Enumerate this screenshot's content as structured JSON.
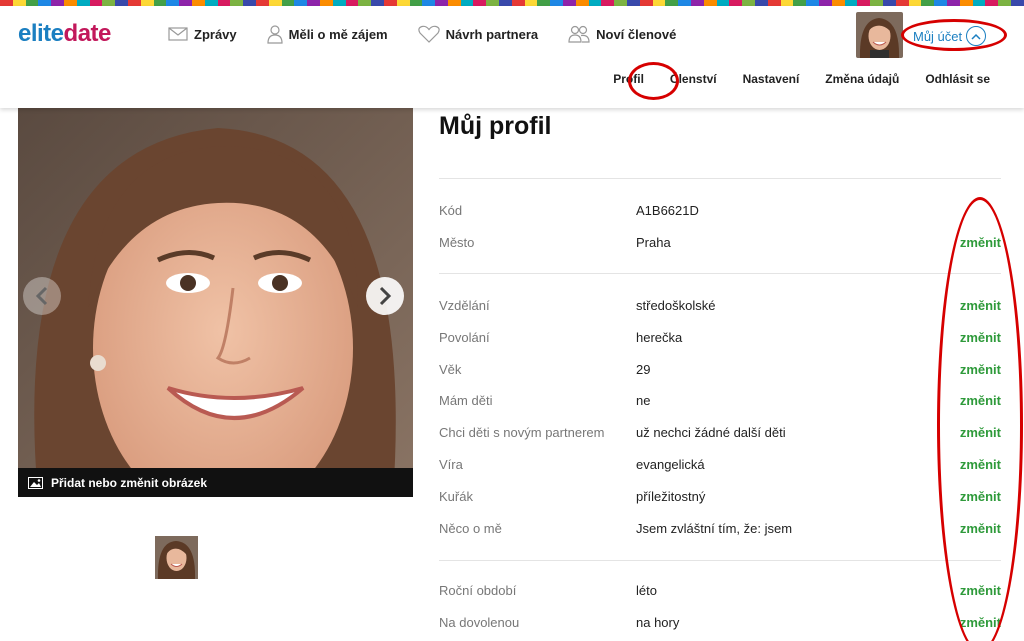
{
  "header": {
    "logo_part1": "elite",
    "logo_part2": "date",
    "nav": [
      {
        "label": "Zprávy",
        "icon": "envelope-icon"
      },
      {
        "label": "Měli o mě zájem",
        "icon": "person-icon"
      },
      {
        "label": "Návrh partnera",
        "icon": "heart-icon"
      },
      {
        "label": "Noví členové",
        "icon": "people-icon"
      }
    ],
    "account_label": "Můj účet",
    "subnav": [
      "Profil",
      "Členství",
      "Nastavení",
      "Změna údajů",
      "Odhlásit se"
    ]
  },
  "photo": {
    "caption": "Přidat nebo změnit obrázek"
  },
  "profile": {
    "title": "Můj profil",
    "change_label": "změnit",
    "group1": [
      {
        "label": "Kód",
        "value": "A1B6621D",
        "editable": false
      },
      {
        "label": "Město",
        "value": "Praha",
        "editable": true
      }
    ],
    "group2": [
      {
        "label": "Vzdělání",
        "value": "středoškolské",
        "editable": true
      },
      {
        "label": "Povolání",
        "value": "herečka",
        "editable": true
      },
      {
        "label": "Věk",
        "value": "29",
        "editable": true
      },
      {
        "label": "Mám děti",
        "value": "ne",
        "editable": true
      },
      {
        "label": "Chci děti s novým partnerem",
        "value": "už nechci žádné další děti",
        "editable": true
      },
      {
        "label": "Víra",
        "value": "evangelická",
        "editable": true
      },
      {
        "label": "Kuřák",
        "value": "příležitostný",
        "editable": true
      },
      {
        "label": "Něco o mě",
        "value": "Jsem zvláštní tím, že: jsem",
        "editable": true
      }
    ],
    "group3": [
      {
        "label": "Roční období",
        "value": "léto",
        "editable": true
      },
      {
        "label": "Na dovolenou",
        "value": "na hory",
        "editable": true
      }
    ]
  },
  "colors": {
    "brand_blue": "#1b7fc1",
    "brand_magenta": "#c2185b",
    "change_green": "#2e9a3a",
    "annotation_red": "#d60000"
  }
}
